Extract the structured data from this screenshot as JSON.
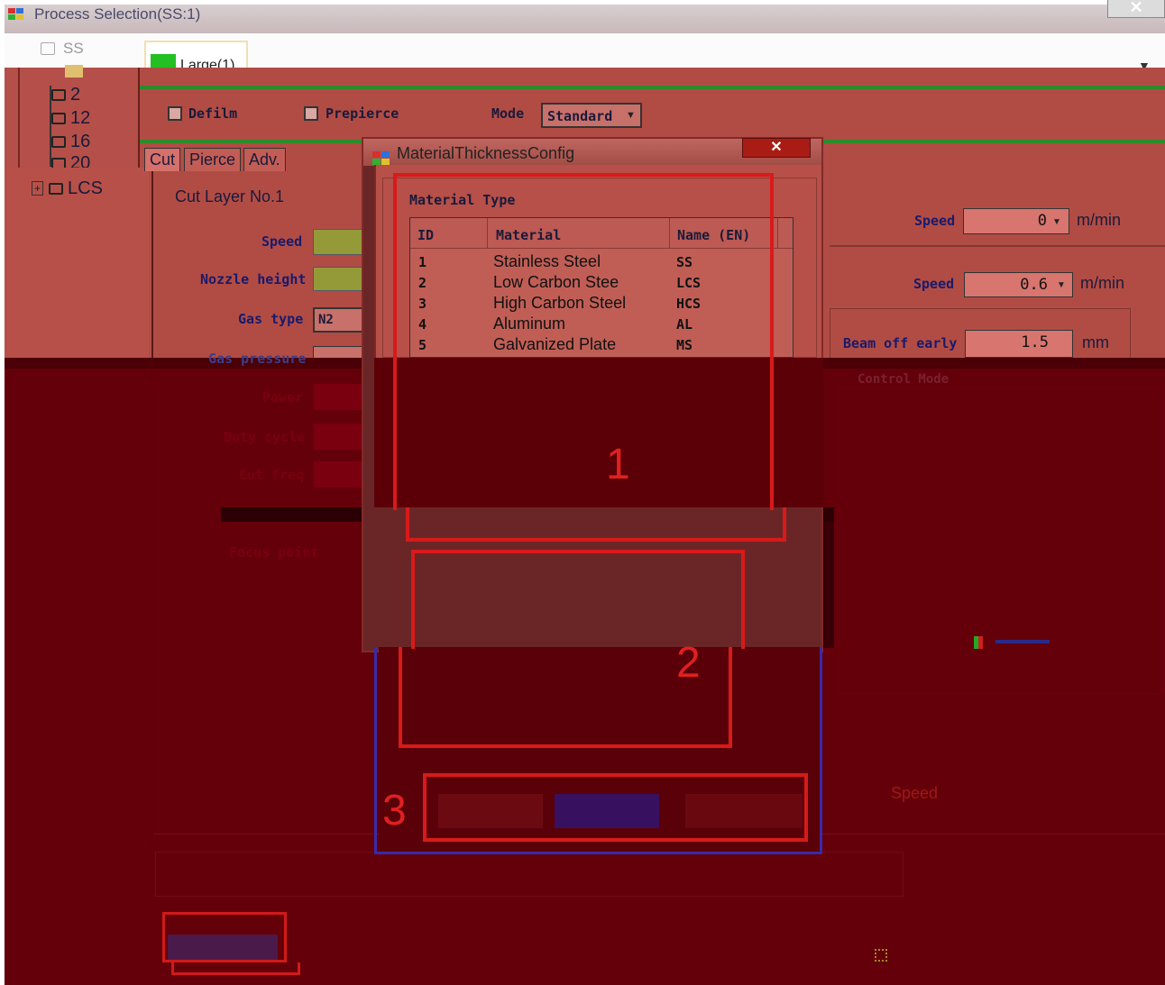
{
  "window": {
    "title": "Process Selection(SS:1)",
    "close_glyph": "✕"
  },
  "tree": {
    "root_label": "SS",
    "items": [
      "2",
      "12",
      "16",
      "20"
    ],
    "collapsed_item": "LCS"
  },
  "top_tab": {
    "label": "Large(1)",
    "swatch_color": "#22c022"
  },
  "options": {
    "defilm_label": "Defilm",
    "prepierce_label": "Prepierce",
    "mode_label": "Mode",
    "mode_value": "Standard"
  },
  "subtabs": [
    "Cut",
    "Pierce",
    "Adv."
  ],
  "cut_layer": {
    "title": "Cut Layer No.1",
    "speed_label": "Speed",
    "nozzle_label": "Nozzle height",
    "gas_type_label": "Gas type",
    "gas_type_value": "N2",
    "gas_pressure_label": "Gas pressure",
    "power_label": "Power",
    "duty_label": "Duty cycle",
    "freq_label": "Cut freq",
    "focus_label": "Focus point"
  },
  "right_panel": {
    "speed1_label": "Speed",
    "speed1_value": "0",
    "speed1_unit": "m/min",
    "speed2_label": "Speed",
    "speed2_value": "0.6",
    "speed2_unit": "m/min",
    "beam_label": "Beam off early",
    "beam_value": "1.5",
    "beam_unit": "mm",
    "control_label": "Control Mode",
    "speed_lower_label": "Speed"
  },
  "dialog": {
    "title": "MaterialThicknessConfig",
    "close_glyph": "✕",
    "group_label": "Material Type",
    "columns": [
      "ID",
      "Material",
      "Name (EN)"
    ],
    "rows": [
      {
        "id": "1",
        "material": "Stainless Steel",
        "name": "SS"
      },
      {
        "id": "2",
        "material": "Low Carbon Stee",
        "name": "LCS"
      },
      {
        "id": "3",
        "material": "High Carbon Steel",
        "name": "HCS"
      },
      {
        "id": "4",
        "material": "Aluminum",
        "name": "AL"
      },
      {
        "id": "5",
        "material": "Galvanized Plate",
        "name": "MS"
      }
    ]
  },
  "annotations": {
    "num1": "1",
    "num2": "2",
    "num3": "3"
  },
  "colors": {
    "annotation_red": "#d81a1a",
    "upper_bg": "#b14c45",
    "lower_bg": "#640009",
    "accent_green": "#2f8a2a"
  }
}
